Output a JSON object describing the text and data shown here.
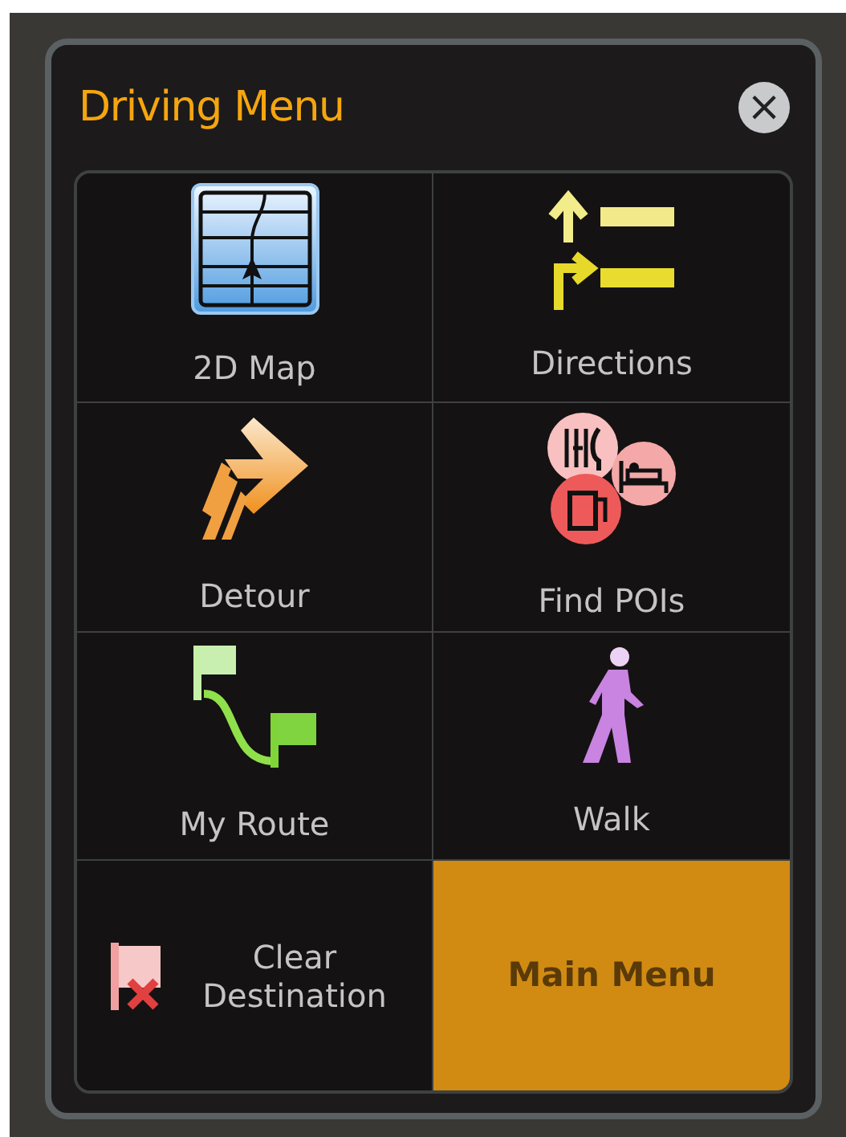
{
  "dialog": {
    "title": "Driving Menu",
    "close": "×"
  },
  "items": [
    {
      "label": "2D Map",
      "kind": "tile",
      "selected": false
    },
    {
      "label": "Directions",
      "kind": "tile",
      "selected": false
    },
    {
      "label": "Detour",
      "kind": "tile",
      "selected": false
    },
    {
      "label": "Find POIs",
      "kind": "tile",
      "selected": false
    },
    {
      "label": "My Route",
      "kind": "tile",
      "selected": false
    },
    {
      "label": "Walk",
      "kind": "tile",
      "selected": false
    },
    {
      "label": "Clear Destination",
      "kind": "row",
      "selected": false
    },
    {
      "label": "Main Menu",
      "kind": "text",
      "selected": true
    }
  ]
}
